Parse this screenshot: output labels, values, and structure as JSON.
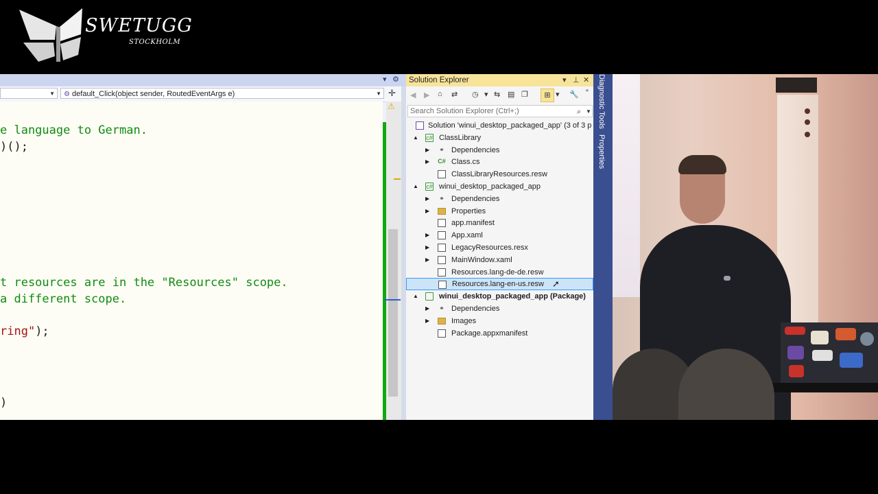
{
  "logo": {
    "title": "SWETUGG",
    "subtitle": "STOCKHOLM"
  },
  "editor": {
    "left_dropdown": "",
    "method_dropdown": "default_Click(object sender, RoutedEventArgs e)",
    "lines": [
      {
        "segments": [
          {
            "cls": "cm",
            "text": "e language to German."
          }
        ]
      },
      {
        "segments": [
          {
            "cls": "tx",
            "text": ")();"
          }
        ]
      },
      {
        "segments": [
          {
            "cls": "cm",
            "text": "t resources are in the \"Resources\" scope."
          }
        ]
      },
      {
        "segments": [
          {
            "cls": "cm",
            "text": "a different scope."
          }
        ]
      },
      {
        "segments": [
          {
            "cls": "str",
            "text": "ring\""
          },
          {
            "cls": "tx",
            "text": ");"
          }
        ]
      },
      {
        "segments": [
          {
            "cls": "tx",
            "text": ")"
          }
        ]
      }
    ]
  },
  "solution_explorer": {
    "title": "Solution Explorer",
    "search_placeholder": "Search Solution Explorer (Ctrl+;)",
    "tree": [
      {
        "label": "Solution 'winui_desktop_packaged_app' (3 of 3 p",
        "icon": "solution-icon",
        "expander": "",
        "level": 0,
        "bold": false,
        "selected": false
      },
      {
        "label": "ClassLibrary",
        "icon": "project-icon",
        "expander": "▲",
        "level": 1,
        "bold": false,
        "selected": false
      },
      {
        "label": "Dependencies",
        "icon": "dependencies-icon",
        "expander": "▶",
        "level": 2,
        "bold": false,
        "selected": false
      },
      {
        "label": "Class.cs",
        "icon": "csharp-file-icon",
        "expander": "▶",
        "level": 2,
        "bold": false,
        "selected": false
      },
      {
        "label": "ClassLibraryResources.resw",
        "icon": "resource-file-icon",
        "expander": "",
        "level": 2,
        "bold": false,
        "selected": false
      },
      {
        "label": "winui_desktop_packaged_app",
        "icon": "project-icon",
        "expander": "▲",
        "level": 1,
        "bold": false,
        "selected": false
      },
      {
        "label": "Dependencies",
        "icon": "dependencies-icon",
        "expander": "▶",
        "level": 2,
        "bold": false,
        "selected": false
      },
      {
        "label": "Properties",
        "icon": "properties-folder-icon",
        "expander": "▶",
        "level": 2,
        "bold": false,
        "selected": false
      },
      {
        "label": "app.manifest",
        "icon": "manifest-file-icon",
        "expander": "",
        "level": 2,
        "bold": false,
        "selected": false
      },
      {
        "label": "App.xaml",
        "icon": "xaml-file-icon",
        "expander": "▶",
        "level": 2,
        "bold": false,
        "selected": false
      },
      {
        "label": "LegacyResources.resx",
        "icon": "resource-file-icon",
        "expander": "▶",
        "level": 2,
        "bold": false,
        "selected": false
      },
      {
        "label": "MainWindow.xaml",
        "icon": "xaml-file-icon",
        "expander": "▶",
        "level": 2,
        "bold": false,
        "selected": false
      },
      {
        "label": "Resources.lang-de-de.resw",
        "icon": "resource-file-icon",
        "expander": "",
        "level": 2,
        "bold": false,
        "selected": false
      },
      {
        "label": "Resources.lang-en-us.resw",
        "icon": "resource-file-icon",
        "expander": "",
        "level": 2,
        "bold": false,
        "selected": true
      },
      {
        "label": "winui_desktop_packaged_app (Package)",
        "icon": "package-project-icon",
        "expander": "▲",
        "level": 1,
        "bold": true,
        "selected": false
      },
      {
        "label": "Dependencies",
        "icon": "dependencies-icon",
        "expander": "▶",
        "level": 2,
        "bold": false,
        "selected": false
      },
      {
        "label": "Images",
        "icon": "folder-icon",
        "expander": "▶",
        "level": 2,
        "bold": false,
        "selected": false
      },
      {
        "label": "Package.appxmanifest",
        "icon": "appxmanifest-file-icon",
        "expander": "",
        "level": 2,
        "bold": false,
        "selected": false
      }
    ]
  },
  "side_tabs": [
    "Diagnostic Tools",
    "Properties"
  ],
  "colors": {
    "comment": "#128a12",
    "string": "#a31515",
    "selection": "#cce4f7",
    "tab_strip": "#3a4f8f",
    "title_active": "#f7e39a"
  }
}
